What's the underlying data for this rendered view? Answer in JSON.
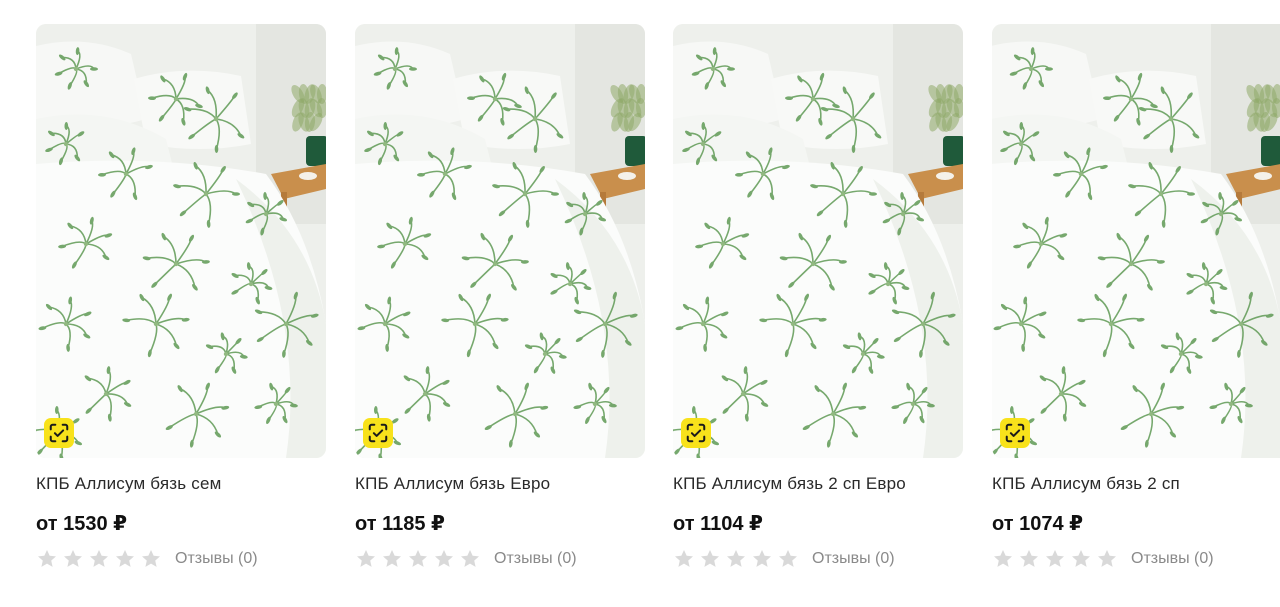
{
  "colors": {
    "badge": "#f8e21b",
    "star_empty": "#d9d9d9",
    "text_primary": "#2a2a2a",
    "text_muted": "#8a8a8a",
    "foliage": "#5f9a55"
  },
  "products": [
    {
      "title": "КПБ Аллисум бязь сем",
      "price": "от 1530 ₽",
      "rating": 0,
      "reviews": "Отзывы (0)",
      "badge_icon": "verified-check-icon"
    },
    {
      "title": "КПБ Аллисум бязь Евро",
      "price": "от 1185 ₽",
      "rating": 0,
      "reviews": "Отзывы (0)",
      "badge_icon": "verified-check-icon"
    },
    {
      "title": "КПБ Аллисум бязь 2 сп Евро",
      "price": "от 1104 ₽",
      "rating": 0,
      "reviews": "Отзывы (0)",
      "badge_icon": "verified-check-icon"
    },
    {
      "title": "КПБ Аллисум бязь 2 сп",
      "price": "от 1074 ₽",
      "rating": 0,
      "reviews": "Отзывы (0)",
      "badge_icon": "verified-check-icon"
    }
  ]
}
